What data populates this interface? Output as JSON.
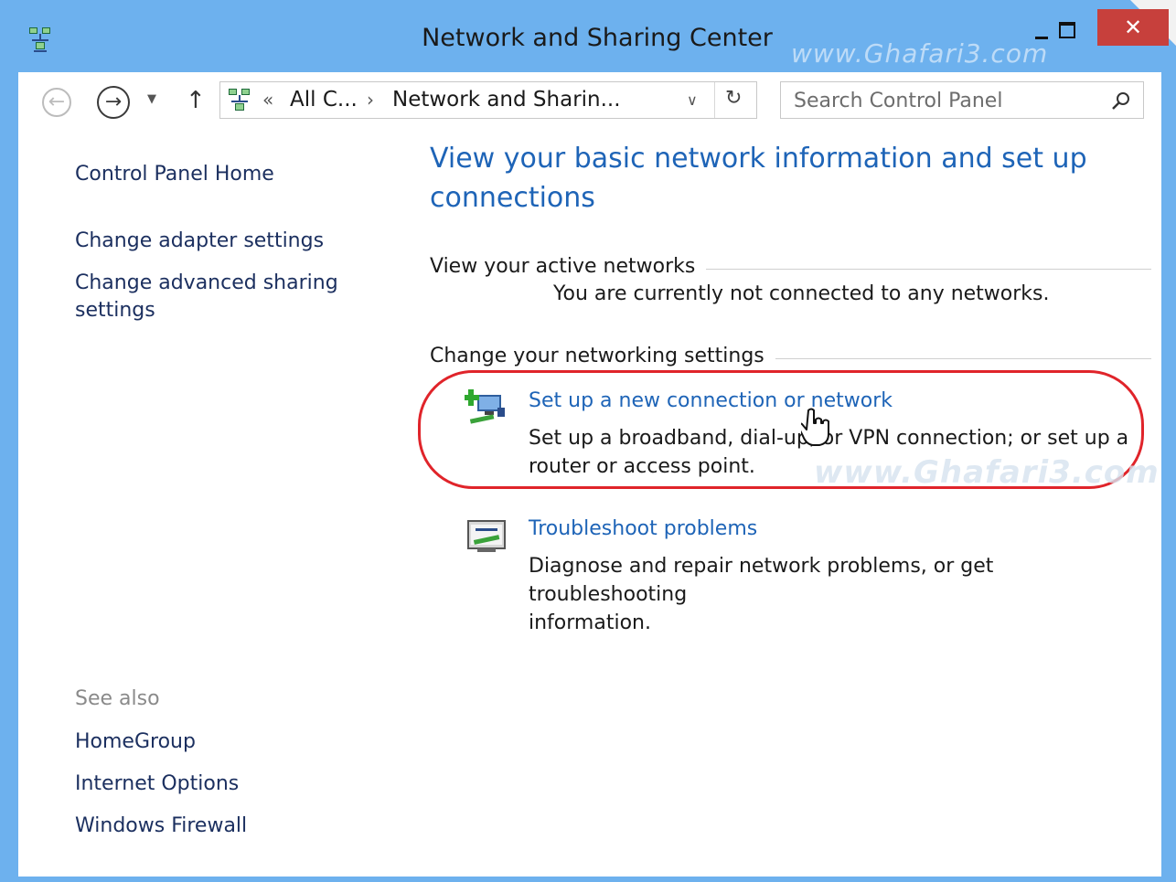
{
  "window": {
    "title": "Network and Sharing Center",
    "watermark": "www.Ghafari3.com",
    "controls": {
      "minimize": "minimize",
      "maximize": "maximize",
      "close": "✕"
    }
  },
  "navigation": {
    "breadcrumb_sep": "«",
    "breadcrumbs": [
      "All C...",
      "Network and Sharin..."
    ],
    "crumb_arrow": "›",
    "search_placeholder": "Search Control Panel"
  },
  "left_pane": {
    "links": [
      "Control Panel Home",
      "Change adapter settings",
      "Change advanced sharing",
      "settings"
    ],
    "see_also_label": "See also",
    "see_also": [
      "HomeGroup",
      "Internet Options",
      "Windows Firewall"
    ]
  },
  "main": {
    "title_line1": "View your basic network information and set up",
    "title_line2": "connections",
    "active_networks_heading": "View your active networks",
    "not_connected": "You are currently not connected to any networks.",
    "settings_heading": "Change your networking settings",
    "tasks": [
      {
        "link": "Set up a new connection or network",
        "desc_line1": "Set up a broadband, dial-up, or VPN connection; or set up a",
        "desc_line2": "router or access point.",
        "icon": "new-connection-icon"
      },
      {
        "link": "Troubleshoot problems",
        "desc_line1": "Diagnose and repair network problems, or get troubleshooting",
        "desc_line2": "information.",
        "icon": "troubleshoot-icon"
      }
    ],
    "watermark": "www.Ghafari3.com"
  },
  "colors": {
    "titlebar": "#6db1ee",
    "link": "#1e64b7",
    "close": "#c7403c",
    "highlight": "#e0242a"
  }
}
